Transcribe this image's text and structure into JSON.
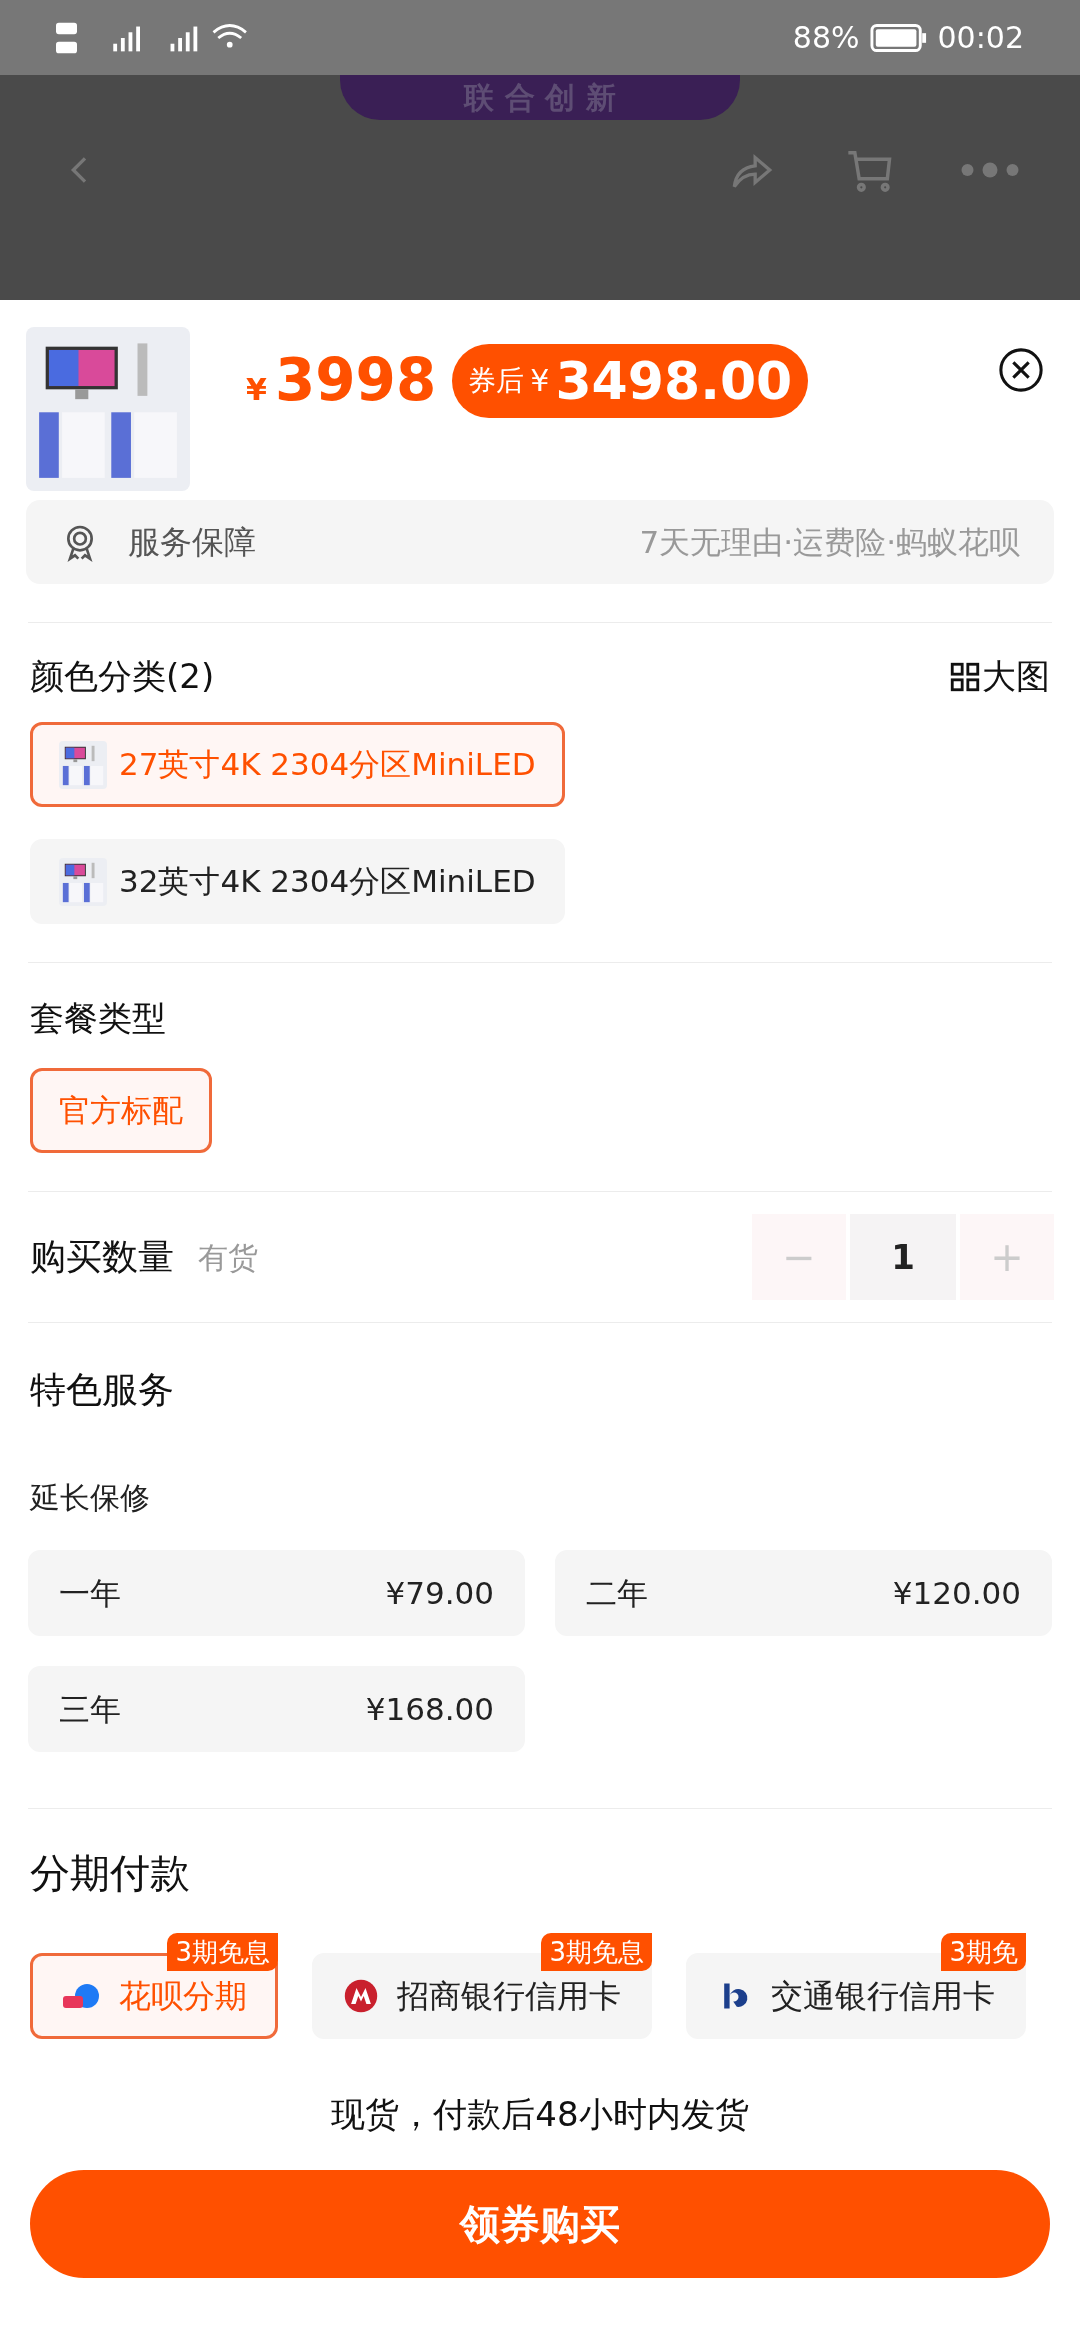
{
  "status_bar": {
    "battery": "88%",
    "time": "00:02"
  },
  "background_banner": {
    "text": "联 合 创 新"
  },
  "product": {
    "price": "3998",
    "currency": "¥",
    "coupon_label": "券后",
    "coupon_price": "3498.00"
  },
  "service": {
    "label": "服务保障",
    "detail": "7天无理由·运费险·蚂蚁花呗"
  },
  "color_section": {
    "title": "颜色分类(2)",
    "view_large": "大图",
    "options": [
      {
        "label": "27英寸4K 2304分区MiniLED",
        "selected": true
      },
      {
        "label": "32英寸4K 2304分区MiniLED",
        "selected": false
      }
    ]
  },
  "package_section": {
    "title": "套餐类型",
    "options": [
      {
        "label": "官方标配",
        "selected": true
      }
    ]
  },
  "quantity": {
    "label": "购买数量",
    "stock": "有货",
    "minus": "−",
    "value": "1",
    "plus": "+"
  },
  "special_service": {
    "title": "特色服务",
    "subtitle": "延长保修",
    "options": [
      {
        "label": "一年",
        "price": "¥79.00",
        "selected": false
      },
      {
        "label": "二年",
        "price": "¥120.00",
        "selected": false
      },
      {
        "label": "三年",
        "price": "¥168.00",
        "selected": false
      }
    ]
  },
  "installment": {
    "title": "分期付款",
    "options": [
      {
        "label": "花呗分期",
        "badge": "3期免息",
        "kind": "huabei",
        "selected": true
      },
      {
        "label": "招商银行信用卡",
        "badge": "3期免息",
        "kind": "cmb",
        "selected": false
      },
      {
        "label": "交通银行信用卡",
        "badge": "3期免",
        "kind": "bocom",
        "selected": false
      }
    ]
  },
  "delivery_note": "现货，付款后48小时内发货",
  "buy_button": "领券购买"
}
